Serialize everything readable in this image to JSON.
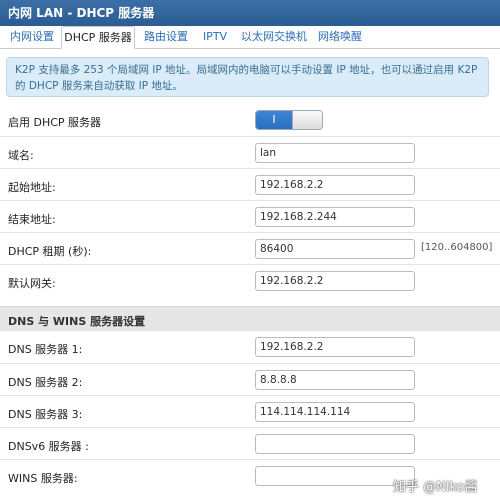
{
  "window": {
    "title": "内网 LAN - DHCP 服务器"
  },
  "tabs": [
    {
      "label": "内网设置"
    },
    {
      "label": "DHCP 服务器"
    },
    {
      "label": "路由设置"
    },
    {
      "label": "IPTV"
    },
    {
      "label": "以太网交换机"
    },
    {
      "label": "网络唤醒"
    }
  ],
  "info_text": "K2P 支持最多 253 个局域网 IP 地址。局域网内的电脑可以手动设置 IP 地址，也可以通过启用 K2P 的 DHCP 服务来自动获取 IP 地址。",
  "dhcp": {
    "enable_label": "启用 DHCP 服务器",
    "enable_state": "I",
    "domain_label": "域名:",
    "domain_value": "lan",
    "start_label": "起始地址:",
    "start_value": "192.168.2.2",
    "end_label": "结束地址:",
    "end_value": "192.168.2.244",
    "lease_label": "DHCP 租期 (秒):",
    "lease_value": "86400",
    "lease_range": "[120..604800]",
    "gateway_label": "默认网关:",
    "gateway_value": "192.168.2.2"
  },
  "dns": {
    "section_title": "DNS 与 WINS 服务器设置",
    "dns1_label": "DNS 服务器 1:",
    "dns1_value": "192.168.2.2",
    "dns2_label": "DNS 服务器 2:",
    "dns2_value": "8.8.8.8",
    "dns3_label": "DNS 服务器 3:",
    "dns3_value": "114.114.114.114",
    "dnsv6_label": "DNSv6 服务器 :",
    "dnsv6_value": "",
    "wins_label": "WINS 服务器:",
    "wins_value": ""
  },
  "watermark": "知乎 @Niko酱",
  "colors": {
    "title_bar": "#2f6399",
    "accent": "#2c6eb6",
    "info_bg": "#d9ecf7",
    "section_bg": "#e6e6e6"
  }
}
